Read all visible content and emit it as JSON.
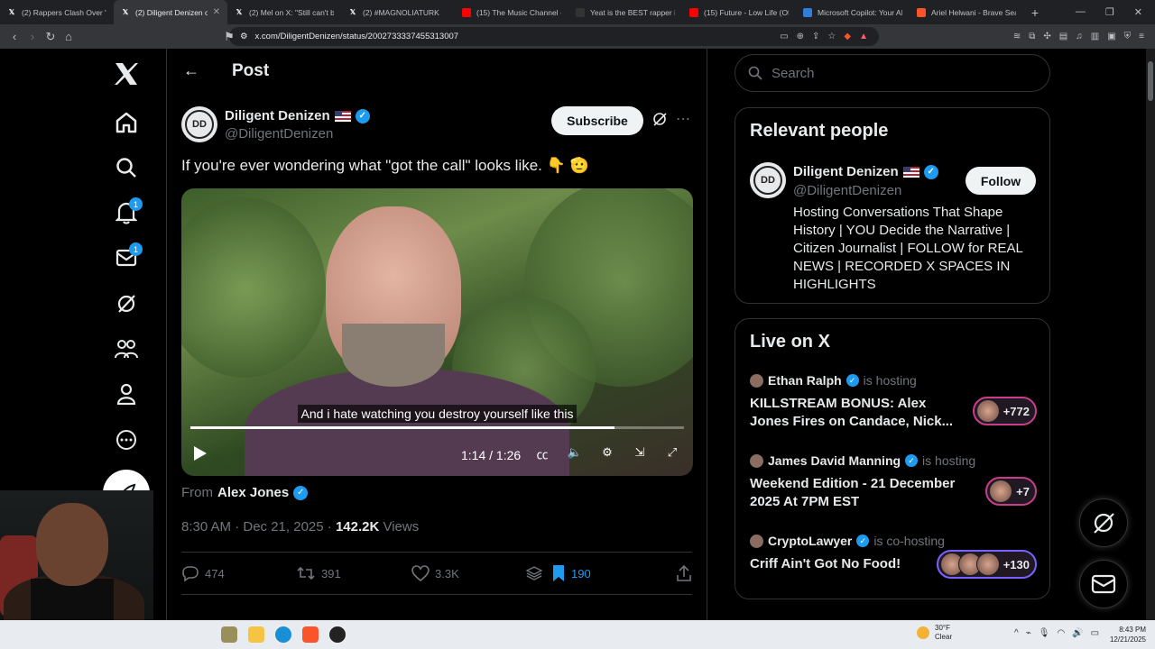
{
  "browser": {
    "tabs": [
      {
        "title": "(2) Rappers Clash Over \"F",
        "favicon": "x-icon",
        "color": "#000000"
      },
      {
        "title": "(2) Diligent Denizen on",
        "favicon": "x-icon",
        "color": "#000000",
        "active": true
      },
      {
        "title": "(2) Mel on X: \"Still can't be",
        "favicon": "x-icon",
        "color": "#000000"
      },
      {
        "title": "(2) #MAGNOLIATURK",
        "favicon": "x-icon",
        "color": "#000000"
      },
      {
        "title": "(15) The Music Channel - Y",
        "favicon": "youtube-icon",
        "color": "#ff0000"
      },
      {
        "title": "Yeat is the BEST rapper in",
        "favicon": "site-icon",
        "color": "#333333"
      },
      {
        "title": "(15) Future - Low Life (Offi",
        "favicon": "youtube-icon",
        "color": "#ff0000"
      },
      {
        "title": "Microsoft Copilot: Your AI",
        "favicon": "copilot-icon",
        "color": "#2f7fd8"
      },
      {
        "title": "Ariel Helwani - Brave Sear",
        "favicon": "brave-icon",
        "color": "#fb542b"
      }
    ],
    "url": "x.com/DiligentDenizen/status/2002733337455313007",
    "brave_shield_badge": "1"
  },
  "nav": {
    "notifications_badge": "1",
    "messages_badge": "1"
  },
  "header": {
    "title": "Post"
  },
  "post": {
    "author_name": "Diligent Denizen",
    "author_handle": "@DiligentDenizen",
    "avatar_text": "DD",
    "subscribe_label": "Subscribe",
    "text": "If you're ever wondering what \"got the call\" looks like. 👇 🫡",
    "video": {
      "caption": "And i hate watching you destroy yourself like this",
      "time": "1:14 / 1:26",
      "progress": 0.86
    },
    "from_label": "From",
    "from_name": "Alex Jones",
    "timestamp": "8:30 AM · Dec 21, 2025 · ",
    "views_count": "142.2K",
    "views_label": " Views",
    "actions": {
      "replies": "474",
      "reposts": "391",
      "likes": "3.3K",
      "bookmarks": "190"
    }
  },
  "sidebar": {
    "search_placeholder": "Search",
    "relevant_people": {
      "title": "Relevant people",
      "name": "Diligent Denizen",
      "handle": "@DiligentDenizen",
      "follow_label": "Follow",
      "bio": "Hosting Conversations That Shape History | YOU Decide the Narrative | Citizen Journalist | FOLLOW for REAL NEWS | RECORDED X SPACES IN HIGHLIGHTS"
    },
    "live": {
      "title": "Live on X",
      "items": [
        {
          "host": "Ethan Ralph",
          "role": "is hosting",
          "title": "KILLSTREAM BONUS: Alex Jones Fires on Candace, Nick...",
          "count": "+772",
          "accent": "#c93d8a"
        },
        {
          "host": "James David Manning",
          "role": "is hosting",
          "title": "Weekend Edition - 21 December 2025 At 7PM EST",
          "count": "+7",
          "accent": "#c93d8a"
        },
        {
          "host": "CryptoLawyer",
          "role": "is co-hosting",
          "title": "Criff Ain't Got No Food!",
          "count": "+130",
          "accent": "#7b61ff"
        }
      ]
    }
  },
  "taskbar": {
    "temp": "30°F",
    "weather": "Clear",
    "time": "8:43 PM",
    "date": "12/21/2025"
  },
  "colors": {
    "accent": "#1d9bf0",
    "background": "#000000",
    "border": "#2f3336",
    "muted": "#71767b"
  }
}
